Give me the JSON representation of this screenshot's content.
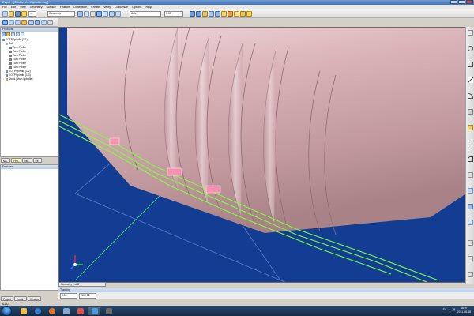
{
  "window": {
    "title": "Esprit - [C:\\Users\\...\\Spindle.esp]"
  },
  "menu": {
    "items": [
      "File",
      "Edit",
      "View",
      "Geometry",
      "Surface",
      "Feature",
      "Dimension",
      "Create",
      "Verify",
      "Customize",
      "Options",
      "Help"
    ]
  },
  "toolbar": {
    "layer_combo": "Geometry",
    "work_combo": "Axis",
    "zoom_combo": "0.00"
  },
  "products_panel": {
    "title": "Products",
    "tree": [
      {
        "label": "EOTPSpindle (1/1)",
        "level": 0
      },
      {
        "label": "Sub",
        "level": 1
      },
      {
        "label": "Turn Profile",
        "level": 2
      },
      {
        "label": "Turn Profile",
        "level": 2
      },
      {
        "label": "Turn Profile",
        "level": 2
      },
      {
        "label": "Turn Profile",
        "level": 2
      },
      {
        "label": "Turn Profile",
        "level": 2
      },
      {
        "label": "Turn Profile",
        "level": 2
      },
      {
        "label": "EOTPSpindle (1/2)",
        "level": 0
      },
      {
        "label": "EOTPSpindle (1/3)",
        "level": 0
      },
      {
        "label": "Stock (Main Spindle)",
        "level": 0
      }
    ],
    "tabs": [
      "Ma..",
      "Fea..",
      "Ma..",
      "Fe.."
    ]
  },
  "features_panel": {
    "title": "Features"
  },
  "bottom_tabs": [
    "Project",
    "Toolbi..",
    "Window"
  ],
  "viewport": {
    "tab_label": "Geometry 1 of 8",
    "background": "#123d93"
  },
  "tracking": {
    "title": "Tracking",
    "x_value": "0.00",
    "y_value": "-100.00"
  },
  "status": {
    "text": "Ready"
  },
  "taskbar": {
    "tray_lang": "SV",
    "time": "18:07",
    "date": "2011-05-18"
  },
  "colors": {
    "accent": "#3f74b8",
    "part_pink": "#d9b3b8",
    "path_green": "#7aff3a",
    "stock_pink": "#ff8fb6"
  }
}
